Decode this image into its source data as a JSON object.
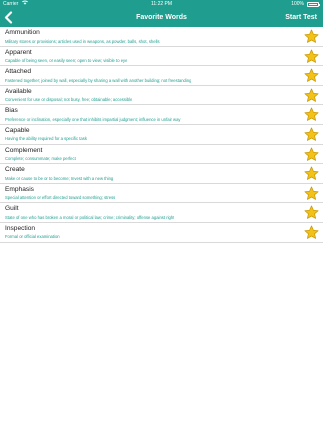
{
  "status_bar": {
    "carrier": "Carrier",
    "time": "11:22 PM",
    "battery": "100%"
  },
  "nav": {
    "back_icon": "chevron-left-icon",
    "title": "Favorite Words",
    "action": "Start Test"
  },
  "colors": {
    "accent": "#1f9e8f",
    "star": "#f2c21b",
    "star_outline": "#c99a08"
  },
  "words": [
    {
      "word": "Ammunition",
      "definition": "Military stores or provisions; articles used in weapons, as powder, balls, shot, shells",
      "favorite_icon": "star-icon"
    },
    {
      "word": "Apparent",
      "definition": "Capable of being seen, or easily seen; open to view; visible to eye",
      "favorite_icon": "star-icon"
    },
    {
      "word": "Attached",
      "definition": "Fastened together; joined by wall, especially by sharing a wall with another building; not freestanding",
      "favorite_icon": "star-icon"
    },
    {
      "word": "Available",
      "definition": "Convenient for use or disposal; not busy, free; obtainable; accessible",
      "favorite_icon": "star-icon"
    },
    {
      "word": "Bias",
      "definition": "Preference or inclination, especially one that inhibits impartial judgment; influence in unfair way",
      "favorite_icon": "star-icon"
    },
    {
      "word": "Capable",
      "definition": "Having the ability required for a specific task",
      "favorite_icon": "star-icon"
    },
    {
      "word": "Complement",
      "definition": "Complete; consummate; make perfect",
      "favorite_icon": "star-icon"
    },
    {
      "word": "Create",
      "definition": "Make or cause to be or to become; Invest with a new thing",
      "favorite_icon": "star-icon"
    },
    {
      "word": "Emphasis",
      "definition": "Special attention or effort directed toward something; stress",
      "favorite_icon": "star-icon"
    },
    {
      "word": "Guilt",
      "definition": "State of one who has broken a moral or political law; crime; criminality; offense against right",
      "favorite_icon": "star-icon"
    },
    {
      "word": "Inspection",
      "definition": "Formal or official examination",
      "favorite_icon": "star-icon"
    }
  ]
}
